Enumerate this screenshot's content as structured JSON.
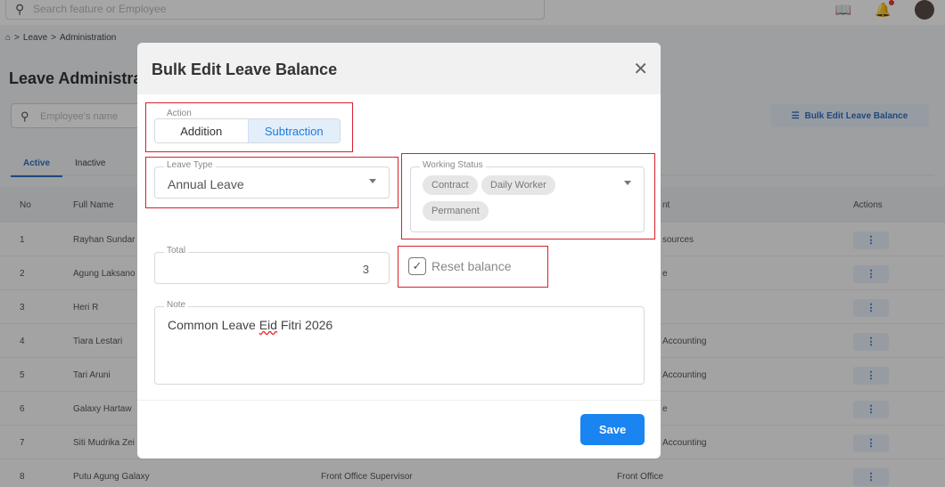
{
  "topbar": {
    "search_placeholder": "Search feature or Employee",
    "icons": [
      "book-icon",
      "bell-icon",
      "avatar"
    ]
  },
  "breadcrumb": {
    "home_icon": "home-icon",
    "items": [
      "Leave",
      "Administration"
    ],
    "separator": ">"
  },
  "page": {
    "title": "Leave Administra",
    "employee_search_placeholder": "Employee's name",
    "bulk_button_label": "Bulk Edit Leave Balance"
  },
  "tabs": [
    {
      "label": "Active"
    },
    {
      "label": "Inactive"
    }
  ],
  "table": {
    "headers": {
      "no": "No",
      "name": "Full Name",
      "dept": "nt",
      "actions": "Actions"
    },
    "rows": [
      {
        "no": "1",
        "name": "Rayhan Sundar",
        "position": "",
        "dept": "sources"
      },
      {
        "no": "2",
        "name": "Agung Laksano",
        "position": "",
        "dept": "e"
      },
      {
        "no": "3",
        "name": "Heri R",
        "position": "",
        "dept": ""
      },
      {
        "no": "4",
        "name": "Tiara Lestari",
        "position": "",
        "dept": "Accounting"
      },
      {
        "no": "5",
        "name": "Tari Aruni",
        "position": "",
        "dept": "Accounting"
      },
      {
        "no": "6",
        "name": "Galaxy Hartaw",
        "position": "",
        "dept": "e"
      },
      {
        "no": "7",
        "name": "Siti Mudrika Zei",
        "position": "",
        "dept": "Accounting"
      },
      {
        "no": "8",
        "name": "Putu Agung Galaxy",
        "position": "Front Office Supervisor",
        "dept": "Front Office"
      }
    ],
    "action_glyph": "⋮"
  },
  "modal": {
    "title": "Bulk Edit Leave Balance",
    "action": {
      "label": "Action",
      "options": [
        "Addition",
        "Subtraction"
      ],
      "selected": "Subtraction"
    },
    "leave_type": {
      "label": "Leave Type",
      "value": "Annual Leave"
    },
    "working_status": {
      "label": "Working Status",
      "chips": [
        "Contract",
        "Daily Worker",
        "Permanent"
      ]
    },
    "total": {
      "label": "Total",
      "value": "3"
    },
    "reset_balance": {
      "label": "Reset balance",
      "checked": true
    },
    "note": {
      "label": "Note",
      "value_before": "Common Leave ",
      "value_misspelled": "Eid",
      "value_after": " Fitri 2026"
    },
    "save_label": "Save"
  },
  "colors": {
    "accent": "#1a84f0",
    "highlight_box": "#d8202b",
    "selected_segment_bg": "#e3eefb"
  }
}
